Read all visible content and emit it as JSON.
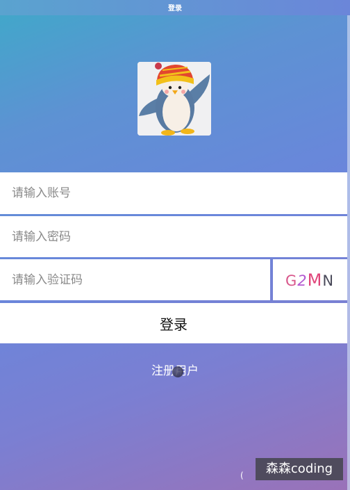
{
  "header": {
    "title": "登录"
  },
  "form": {
    "account_placeholder": "请输入账号",
    "password_placeholder": "请输入密码",
    "captcha_placeholder": "请输入验证码",
    "captcha_code": {
      "c1": "G",
      "c2": "2",
      "c3": "M",
      "c4": "N"
    },
    "login_label": "登录",
    "register_label": "注册用户"
  },
  "footer": {
    "small_glyph": "(",
    "watermark": "森森coding"
  },
  "colors": {
    "gradient_start": "#3fa9c9",
    "gradient_mid": "#6a86db",
    "gradient_end": "#9a72b8",
    "field_bg": "#ffffff"
  },
  "icons": {
    "avatar": "penguin-avatar-icon"
  }
}
